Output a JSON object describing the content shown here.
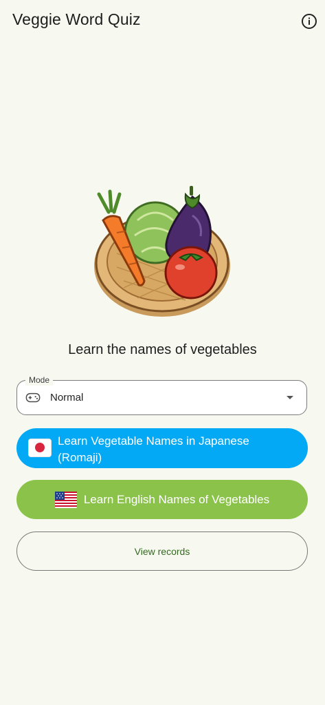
{
  "app": {
    "title": "Veggie Word Quiz",
    "info_icon": "info-icon"
  },
  "hero": {
    "image": "vegetable-basket-illustration"
  },
  "tagline": "Learn the names of vegetables",
  "mode": {
    "label": "Mode",
    "value": "Normal",
    "icon": "gamepad-icon"
  },
  "buttons": {
    "japanese": {
      "label": "Learn Vegetable Names in Japanese\n(Romaji)",
      "icon": "japan-flag-icon",
      "color": "#03a9f4"
    },
    "english": {
      "label": "Learn English Names of Vegetables",
      "icon": "us-flag-icon",
      "color": "#8bc34a"
    },
    "records": {
      "label": "View records"
    }
  },
  "colors": {
    "background": "#f7f9f0",
    "records_text": "#33691e"
  }
}
